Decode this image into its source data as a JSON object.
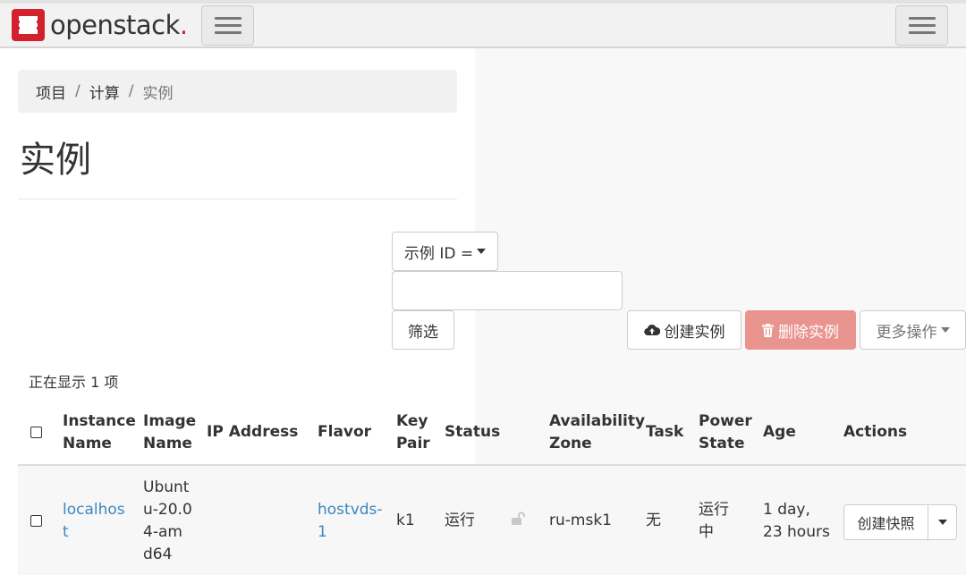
{
  "brand": {
    "name": "openstack",
    "dot": "."
  },
  "breadcrumb": {
    "items": [
      "项目",
      "计算",
      "实例"
    ],
    "separator": "/"
  },
  "page": {
    "title": "实例"
  },
  "filter": {
    "type_label": "示例 ID =",
    "input_value": "",
    "filter_label": "筛选"
  },
  "actions": {
    "create_label": "创建实例",
    "delete_label": "删除实例",
    "more_label": "更多操作"
  },
  "summary": {
    "count_text": "正在显示 1 项"
  },
  "table": {
    "columns": [
      {
        "line1": "Instance",
        "line2": "Name"
      },
      {
        "line1": "Image",
        "line2": "Name"
      },
      {
        "line1": "IP Address",
        "line2": ""
      },
      {
        "line1": "Flavor",
        "line2": ""
      },
      {
        "line1": "Key",
        "line2": "Pair"
      },
      {
        "line1": "Status",
        "line2": ""
      },
      {
        "line1": "Availability",
        "line2": "Zone"
      },
      {
        "line1": "Task",
        "line2": ""
      },
      {
        "line1": "Power",
        "line2": "State"
      },
      {
        "line1": "Age",
        "line2": ""
      },
      {
        "line1": "Actions",
        "line2": ""
      }
    ],
    "rows": [
      {
        "instance_name": [
          "localhos",
          "t"
        ],
        "image_name": [
          "Ubunt",
          "u-20.0",
          "4-am",
          "d64"
        ],
        "ip_address": "",
        "flavor": [
          "hostvds-",
          "1"
        ],
        "key_pair": "k1",
        "status": "运行",
        "availability_zone": "ru-msk1",
        "task": "无",
        "power_state": [
          "运行",
          "中"
        ],
        "age": [
          "1 day,",
          "23 hours"
        ],
        "action_label": "创建快照"
      }
    ]
  },
  "colors": {
    "brand_red": "#d3202f",
    "link": "#3a87c0",
    "danger": "#e9948f"
  },
  "icons": [
    "menu-icon",
    "cloud-upload-icon",
    "trash-icon",
    "lock-open-icon",
    "caret-down-icon"
  ]
}
